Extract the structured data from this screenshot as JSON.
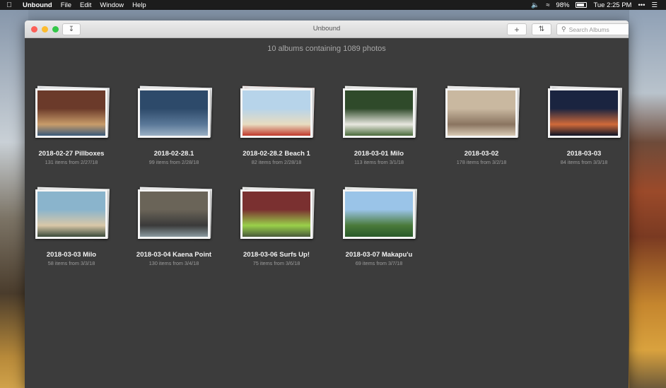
{
  "menubar": {
    "apple": "",
    "app_name": "Unbound",
    "menus": [
      "File",
      "Edit",
      "Window",
      "Help"
    ],
    "battery": "98%",
    "clock": "Tue 2:25 PM",
    "more": "•••",
    "icons": [
      "volume-icon",
      "wifi-icon",
      "battery-icon",
      "control-center-icon"
    ]
  },
  "window": {
    "title": "Unbound",
    "search_placeholder": "Search Albums",
    "add_label": "+",
    "summary": "10 albums containing 1089 photos"
  },
  "albums": [
    {
      "name": "2018-02-27 Pillboxes",
      "meta": "131 items from 2/27/18",
      "colors": [
        "#6b3a2a",
        "#c89c6a",
        "#3a5a7a"
      ]
    },
    {
      "name": "2018-02-28.1",
      "meta": "99 items from 2/28/18",
      "colors": [
        "#2d4a6a",
        "#5a7898",
        "#9ab0c4"
      ]
    },
    {
      "name": "2018-02-28.2 Beach 1",
      "meta": "82 items from 2/28/18",
      "colors": [
        "#b7d4ea",
        "#e8dcc0",
        "#c0392b"
      ]
    },
    {
      "name": "2018-03-01 Milo",
      "meta": "113 items from 3/1/18",
      "colors": [
        "#2f4a2a",
        "#e8e8e0",
        "#4a6a3a"
      ]
    },
    {
      "name": "2018-03-02",
      "meta": "178 items from 3/2/18",
      "colors": [
        "#c9b8a0",
        "#8a7460",
        "#d8cab4"
      ]
    },
    {
      "name": "2018-03-03",
      "meta": "84 items from 3/3/18",
      "colors": [
        "#1a2440",
        "#d06a3a",
        "#0d1426"
      ]
    },
    {
      "name": "2018-03-03 Milo",
      "meta": "58 items from 3/3/18",
      "colors": [
        "#8ab4cc",
        "#d9c8a8",
        "#3a4a3a"
      ]
    },
    {
      "name": "2018-03-04 Kaena Point",
      "meta": "130 items from 3/4/18",
      "colors": [
        "#6a6458",
        "#3a3a3a",
        "#8a9aa0"
      ]
    },
    {
      "name": "2018-03-06 Surfs Up!",
      "meta": "75 items from 3/6/18",
      "colors": [
        "#7a3030",
        "#9ad04a",
        "#4a5a3a"
      ]
    },
    {
      "name": "2018-03-07 Makapu'u",
      "meta": "69 items from 3/7/18",
      "colors": [
        "#9ac4e8",
        "#4a7a3a",
        "#2a5a2a"
      ]
    }
  ]
}
